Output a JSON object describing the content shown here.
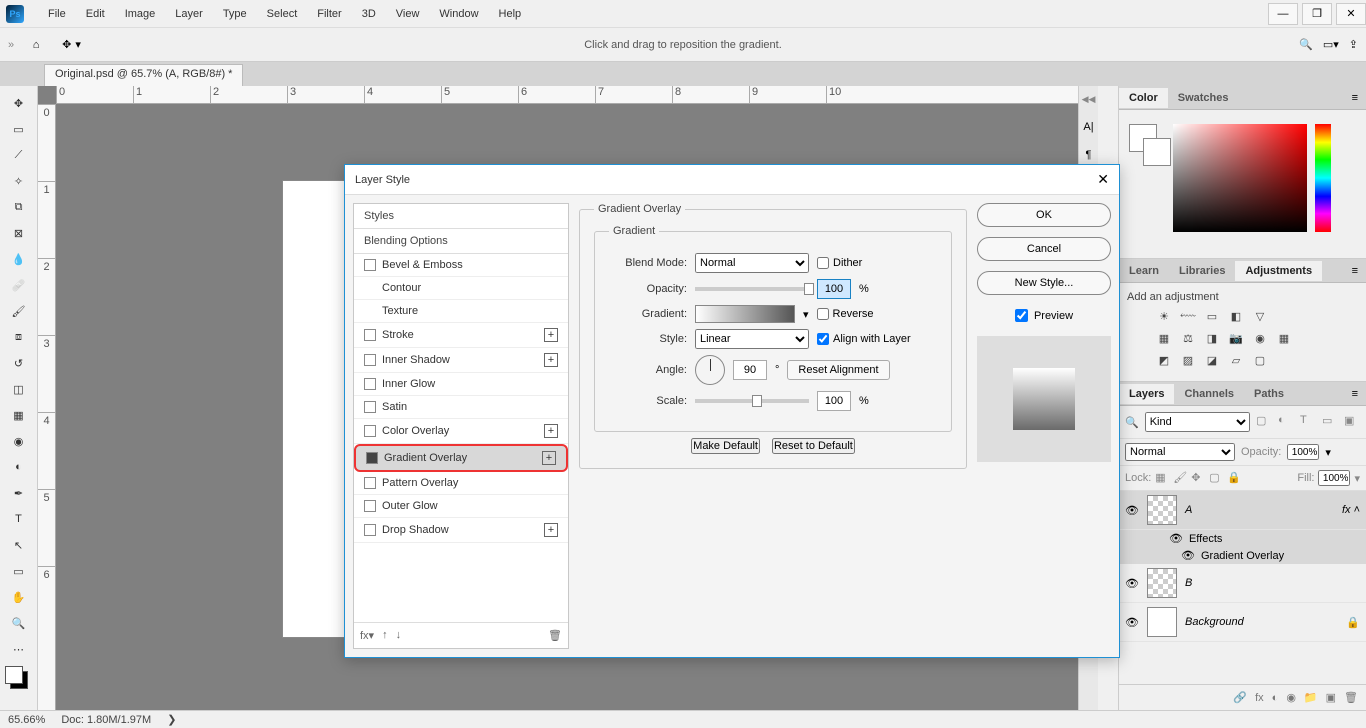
{
  "menu": [
    "File",
    "Edit",
    "Image",
    "Layer",
    "Type",
    "Select",
    "Filter",
    "3D",
    "View",
    "Window",
    "Help"
  ],
  "options_hint": "Click and drag to reposition the gradient.",
  "doc_tab": "Original.psd @ 65.7% (A, RGB/8#) *",
  "ruler_h": [
    "0",
    "1",
    "2",
    "3",
    "4",
    "5",
    "6",
    "7",
    "8",
    "9",
    "10"
  ],
  "ruler_v": [
    "0",
    "1",
    "2",
    "3",
    "4",
    "5",
    "6"
  ],
  "status": {
    "zoom": "65.66%",
    "doc": "Doc: 1.80M/1.97M"
  },
  "panels": {
    "color_tab": "Color",
    "swatches_tab": "Swatches",
    "learn_tab": "Learn",
    "libraries_tab": "Libraries",
    "adjustments_tab": "Adjustments",
    "adjust_label": "Add an adjustment",
    "layers_tab": "Layers",
    "channels_tab": "Channels",
    "paths_tab": "Paths",
    "kind": "Kind",
    "normal": "Normal",
    "opacity_lbl": "Opacity:",
    "opacity_val": "100%",
    "lock_lbl": "Lock:",
    "fill_lbl": "Fill:",
    "fill_val": "100%",
    "layers": [
      {
        "name": "A",
        "selected": true,
        "fx": true
      },
      {
        "name": "B"
      },
      {
        "name": "Background",
        "locked": true
      }
    ],
    "effects_lbl": "Effects",
    "effect1": "Gradient Overlay"
  },
  "dialog": {
    "title": "Layer Style",
    "list": {
      "styles": "Styles",
      "blending": "Blending Options",
      "items": [
        {
          "label": "Bevel & Emboss"
        },
        {
          "label": "Contour",
          "indent": true
        },
        {
          "label": "Texture",
          "indent": true
        },
        {
          "label": "Stroke",
          "plus": true
        },
        {
          "label": "Inner Shadow",
          "plus": true
        },
        {
          "label": "Inner Glow"
        },
        {
          "label": "Satin"
        },
        {
          "label": "Color Overlay",
          "plus": true
        },
        {
          "label": "Gradient Overlay",
          "plus": true,
          "checked": true,
          "highlighted": true
        },
        {
          "label": "Pattern Overlay"
        },
        {
          "label": "Outer Glow"
        },
        {
          "label": "Drop Shadow",
          "plus": true
        }
      ]
    },
    "settings": {
      "section": "Gradient Overlay",
      "inner_section": "Gradient",
      "blend_mode_lbl": "Blend Mode:",
      "blend_mode": "Normal",
      "dither": "Dither",
      "opacity_lbl": "Opacity:",
      "opacity": "100",
      "pct": "%",
      "gradient_lbl": "Gradient:",
      "reverse": "Reverse",
      "style_lbl": "Style:",
      "style": "Linear",
      "align": "Align with Layer",
      "angle_lbl": "Angle:",
      "angle": "90",
      "deg": "°",
      "reset_align": "Reset Alignment",
      "scale_lbl": "Scale:",
      "scale": "100",
      "make_default": "Make Default",
      "reset_default": "Reset to Default"
    },
    "side": {
      "ok": "OK",
      "cancel": "Cancel",
      "new_style": "New Style...",
      "preview": "Preview"
    }
  }
}
